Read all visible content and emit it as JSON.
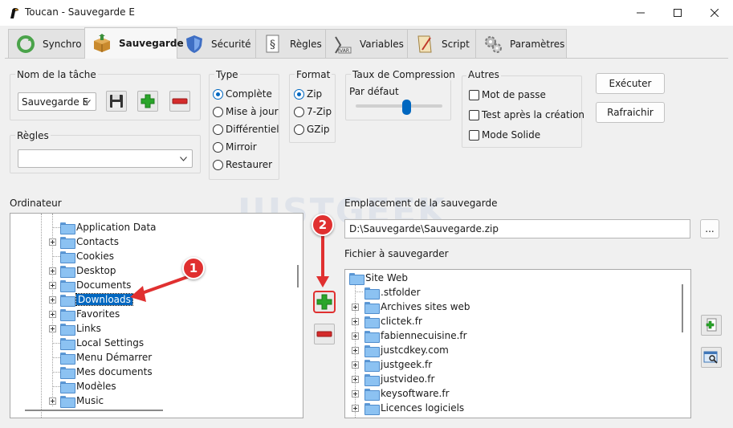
{
  "window": {
    "title": "Toucan - Sauvegarde E"
  },
  "tabs": [
    {
      "label": "Synchro",
      "icon": "sync-icon"
    },
    {
      "label": "Sauvegarde",
      "icon": "backup-box-icon",
      "active": true
    },
    {
      "label": "Sécurité",
      "icon": "shield-icon"
    },
    {
      "label": "Règles",
      "icon": "rules-document-icon"
    },
    {
      "label": "Variables",
      "icon": "variables-icon"
    },
    {
      "label": "Script",
      "icon": "script-icon"
    },
    {
      "label": "Paramètres",
      "icon": "gears-icon"
    }
  ],
  "task": {
    "label": "Nom de la tâche",
    "value": "Sauvegarde E"
  },
  "rules": {
    "label": "Règles",
    "value": ""
  },
  "type": {
    "label": "Type",
    "options": [
      "Complète",
      "Mise à jour",
      "Différentiel",
      "Mirroir",
      "Restaurer"
    ],
    "selected": "Complète"
  },
  "format": {
    "label": "Format",
    "options": [
      "Zip",
      "7-Zip",
      "GZip"
    ],
    "selected": "Zip"
  },
  "compression": {
    "label": "Taux de Compression",
    "value_label": "Par défaut",
    "level": 0.6
  },
  "other": {
    "label": "Autres",
    "options": [
      "Mot de passe",
      "Test après la création",
      "Mode Solide"
    ]
  },
  "buttons": {
    "run": "Exécuter",
    "refresh": "Rafraichir",
    "browse": "..."
  },
  "computer": {
    "label": "Ordinateur",
    "items": [
      "Application Data",
      "Contacts",
      "Cookies",
      "Desktop",
      "Documents",
      "Downloads",
      "Favorites",
      "Links",
      "Local Settings",
      "Menu Démarrer",
      "Mes documents",
      "Modèles",
      "Music"
    ],
    "selected": "Downloads"
  },
  "destination": {
    "label": "Emplacement de la sauvegarde",
    "value": "D:\\Sauvegarde\\Sauvegarde.zip"
  },
  "files": {
    "label": "Fichier à sauvegarder",
    "root": "Site Web",
    "items": [
      ".stfolder",
      "Archives sites web",
      "clictek.fr",
      "fabiennecuisine.fr",
      "justcdkey.com",
      "justgeek.fr",
      "justvideo.fr",
      "keysoftware.fr",
      "Licences logiciels"
    ]
  },
  "annotations": {
    "badge1": "1",
    "badge2": "2",
    "watermark": "JUSTGEEK"
  },
  "colors": {
    "accent": "#0067c0",
    "annotation": "#e03030",
    "add": "#2aa52a",
    "remove": "#d42b2b"
  }
}
